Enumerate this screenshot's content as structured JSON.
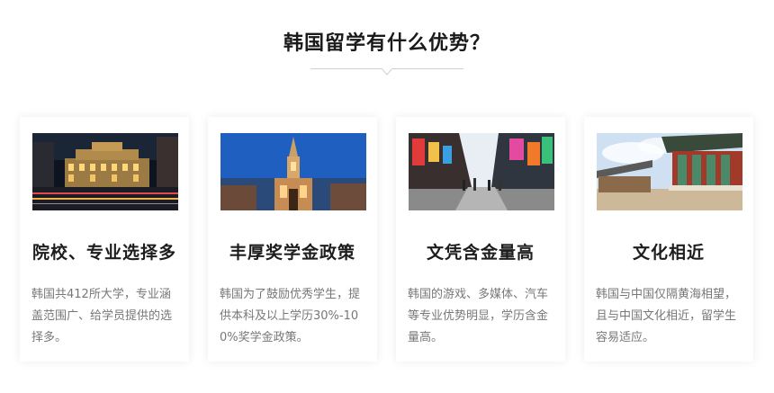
{
  "section": {
    "title": "韩国留学有什么优势？"
  },
  "cards": [
    {
      "title": "院校、专业选择多",
      "description": "韩国共412所大学，专业涵盖范围广、给学员提供的选择多。",
      "image_icon": "city-night-building-photo"
    },
    {
      "title": "丰厚奖学金政策",
      "description": "韩国为了鼓励优秀学生，提供本科及以上学历30%-100%奖学金政策。",
      "image_icon": "cathedral-photo"
    },
    {
      "title": "文凭含金量高",
      "description": "韩国的游戏、多媒体、汽车等专业优势明显，学历含金量高。",
      "image_icon": "shopping-street-photo"
    },
    {
      "title": "文化相近",
      "description": "韩国与中国仅隔黄海相望，且与中国文化相近，留学生容易适应。",
      "image_icon": "palace-photo"
    }
  ],
  "colors": {
    "title": "#1a1a1a",
    "card_title": "#1d1d1d",
    "description": "#777777",
    "divider": "#cfcfcf"
  }
}
